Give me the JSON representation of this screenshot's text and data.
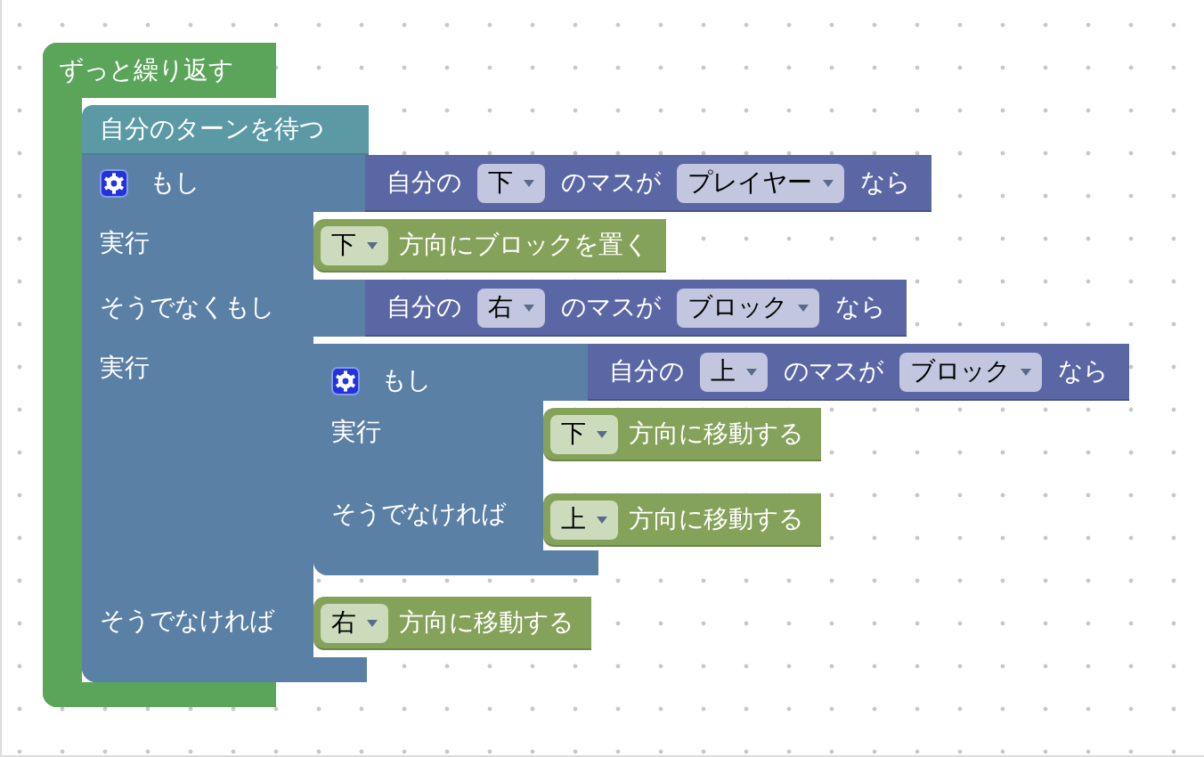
{
  "workspace": {
    "blocks": [
      {
        "kind": "loop",
        "label": "ずっと繰り返す",
        "body": [
          {
            "kind": "wait",
            "label": "自分のターンを待つ"
          },
          {
            "kind": "if",
            "mutator": true,
            "branches": [
              {
                "label": "もし",
                "condition": {
                  "kind": "compare",
                  "prefix": "自分の",
                  "direction": "下",
                  "middle": "のマスが",
                  "target": "プレイヤー",
                  "suffix": "なら"
                },
                "do_label": "実行",
                "do": [
                  {
                    "kind": "action",
                    "direction": "下",
                    "label": "方向にブロックを置く"
                  }
                ]
              },
              {
                "label": "そうでなくもし",
                "condition": {
                  "kind": "compare",
                  "prefix": "自分の",
                  "direction": "右",
                  "middle": "のマスが",
                  "target": "ブロック",
                  "suffix": "なら"
                },
                "do_label": "実行",
                "do": [
                  {
                    "kind": "if",
                    "mutator": true,
                    "branches": [
                      {
                        "label": "もし",
                        "condition": {
                          "kind": "compare",
                          "prefix": "自分の",
                          "direction": "上",
                          "middle": "のマスが",
                          "target": "ブロック",
                          "suffix": "なら"
                        },
                        "do_label": "実行",
                        "do": [
                          {
                            "kind": "action",
                            "direction": "下",
                            "label": "方向に移動する"
                          }
                        ]
                      }
                    ],
                    "else_label": "そうでなければ",
                    "else": [
                      {
                        "kind": "action",
                        "direction": "上",
                        "label": "方向に移動する"
                      }
                    ]
                  }
                ]
              }
            ],
            "else_label": "そうでなければ",
            "else": [
              {
                "kind": "action",
                "direction": "右",
                "label": "方向に移動する"
              }
            ]
          }
        ]
      }
    ]
  }
}
